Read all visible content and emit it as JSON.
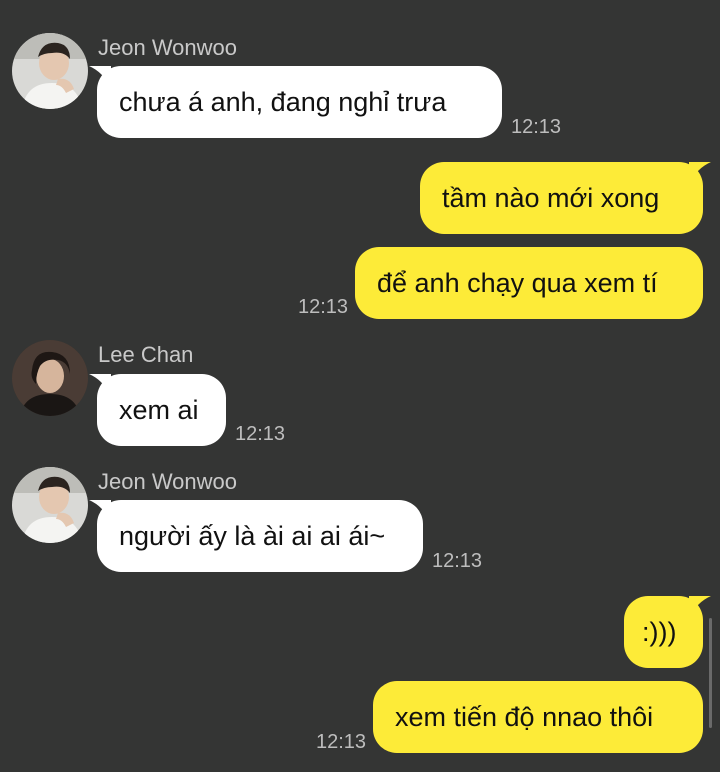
{
  "messages": [
    {
      "sender": "Jeon Wonwoo",
      "text": "chưa á anh, đang nghỉ trưa",
      "time": "12:13"
    },
    {
      "text": "tầm nào mới xong"
    },
    {
      "text": "để anh chạy qua xem tí",
      "time": "12:13"
    },
    {
      "sender": "Lee Chan",
      "text": "xem ai",
      "time": "12:13"
    },
    {
      "sender": "Jeon Wonwoo",
      "text": "người ấy là ài ai ai ái~",
      "time": "12:13"
    },
    {
      "text": ":)))"
    },
    {
      "text": "xem tiến độ nnao thôi",
      "time": "12:13"
    }
  ],
  "colors": {
    "background": "#343534",
    "incoming_bubble": "#ffffff",
    "outgoing_bubble": "#fdeb38",
    "sender_name": "#c9c9c9",
    "timestamp": "#bdbdbd"
  },
  "avatars": [
    "jeon-wonwoo-avatar",
    "lee-chan-avatar",
    "jeon-wonwoo-avatar"
  ]
}
